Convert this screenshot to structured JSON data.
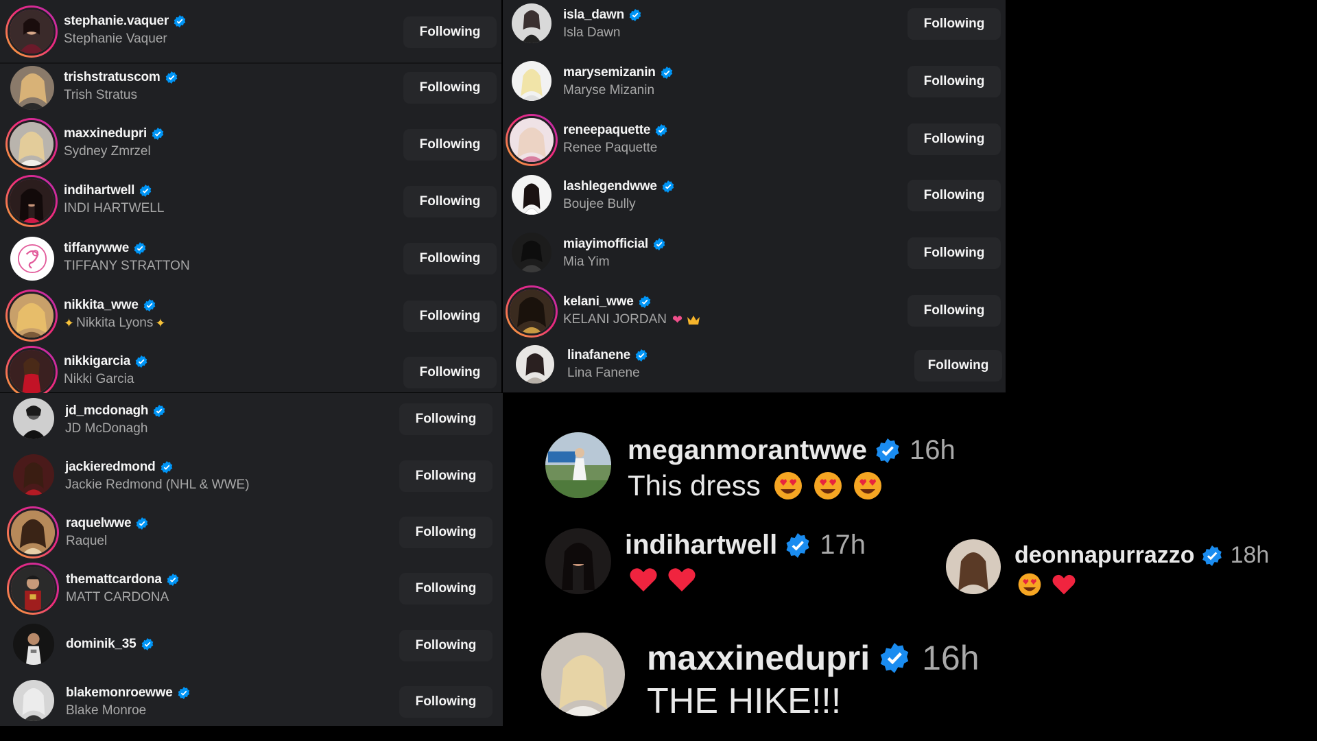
{
  "colors": {
    "accent_verified": "#0095f6",
    "ring_start": "#f9b233",
    "ring_mid": "#ee2a7b",
    "ring_end": "#b52cb3",
    "heart": "#f0243f"
  },
  "icons": {
    "verified": "verified-badge-icon",
    "heart": "red-heart-icon",
    "love_eyes": "heart-eyes-emoji-icon",
    "sparkles": "sparkles-emoji-icon",
    "crown": "crown-emoji-icon",
    "two_hearts": "two-hearts-emoji-icon"
  },
  "following_a": [
    {
      "handle": "stephanie.vaquer",
      "name": "Stephanie Vaquer",
      "button": "Following"
    },
    {
      "handle": "trishstratuscom",
      "name": "Trish Stratus",
      "button": "Following"
    },
    {
      "handle": "maxxinedupri",
      "name": "Sydney Zmrzel",
      "button": "Following"
    },
    {
      "handle": "indihartwell",
      "name": "INDI HARTWELL",
      "button": "Following"
    },
    {
      "handle": "tiffanywwe",
      "name": "TIFFANY STRATTON",
      "button": "Following"
    },
    {
      "handle": "nikkita_wwe",
      "name": "Nikkita Lyons",
      "button": "Following"
    },
    {
      "handle": "nikkigarcia",
      "name": "Nikki Garcia",
      "button": "Following"
    }
  ],
  "following_b": [
    {
      "handle": "isla_dawn",
      "name": "Isla Dawn",
      "button": "Following"
    },
    {
      "handle": "marysemizanin",
      "name": "Maryse Mizanin",
      "button": "Following"
    },
    {
      "handle": "reneepaquette",
      "name": "Renee Paquette",
      "button": "Following"
    },
    {
      "handle": "lashlegendwwe",
      "name": "Boujee Bully",
      "button": "Following"
    },
    {
      "handle": "miayimofficial",
      "name": "Mia Yim",
      "button": "Following"
    },
    {
      "handle": "kelani_wwe",
      "name": "KELANI JORDAN",
      "button": "Following"
    },
    {
      "handle": "linafanene",
      "name": "Lina Fanene",
      "button": "Following"
    }
  ],
  "following_c": [
    {
      "handle": "jd_mcdonagh",
      "name": "JD McDonagh",
      "button": "Following"
    },
    {
      "handle": "jackieredmond",
      "name": "Jackie Redmond (NHL & WWE)",
      "button": "Following"
    },
    {
      "handle": "raquelwwe",
      "name": "Raquel",
      "button": "Following"
    },
    {
      "handle": "themattcardona",
      "name": "MATT CARDONA",
      "button": "Following"
    },
    {
      "handle": "dominik_35",
      "name": "",
      "button": "Following"
    },
    {
      "handle": "blakemonroewwe",
      "name": "Blake Monroe",
      "button": "Following"
    }
  ],
  "comments": [
    {
      "handle": "meganmorantwwe",
      "time": "16h",
      "text": "This dress"
    },
    {
      "handle": "indihartwell",
      "time": "17h",
      "text": ""
    },
    {
      "handle": "deonnapurrazzo",
      "time": "18h",
      "text": ""
    },
    {
      "handle": "maxxinedupri",
      "time": "16h",
      "text": "THE HIKE!!!"
    }
  ]
}
